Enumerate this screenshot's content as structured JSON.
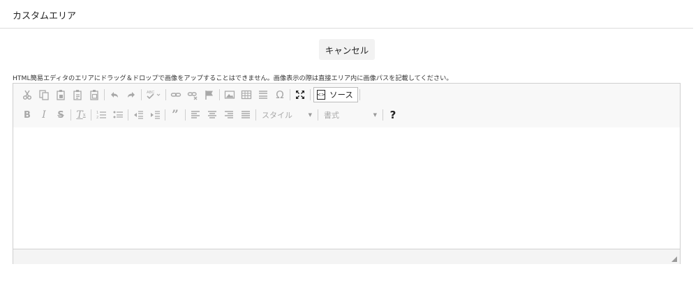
{
  "header": {
    "title": "カスタムエリア"
  },
  "actions": {
    "cancel_label": "キャンセル"
  },
  "notice": "HTML簡易エディタのエリアにドラッグ＆ドロップで画像をアップすることはできません。画像表示の際は直接エリア内に画像パスを記載してください。",
  "toolbar": {
    "source_label": "ソース",
    "style_label": "スタイル",
    "format_label": "書式",
    "help_label": "?",
    "spell_label": "ABC",
    "row1_icons": [
      "cut-icon",
      "copy-icon",
      "paste-icon",
      "paste-text-icon",
      "paste-word-icon",
      "undo-icon",
      "redo-icon",
      "spellcheck-icon",
      "link-icon",
      "unlink-icon",
      "anchor-icon",
      "image-icon",
      "table-icon",
      "horizontal-rule-icon",
      "special-char-icon",
      "maximize-icon",
      "source-icon"
    ],
    "row2_icons": [
      "bold-icon",
      "italic-icon",
      "strike-icon",
      "remove-format-icon",
      "numbered-list-icon",
      "bulleted-list-icon",
      "outdent-icon",
      "indent-icon",
      "blockquote-icon",
      "align-left-icon",
      "align-center-icon",
      "align-right-icon",
      "align-justify-icon",
      "help-icon"
    ]
  }
}
